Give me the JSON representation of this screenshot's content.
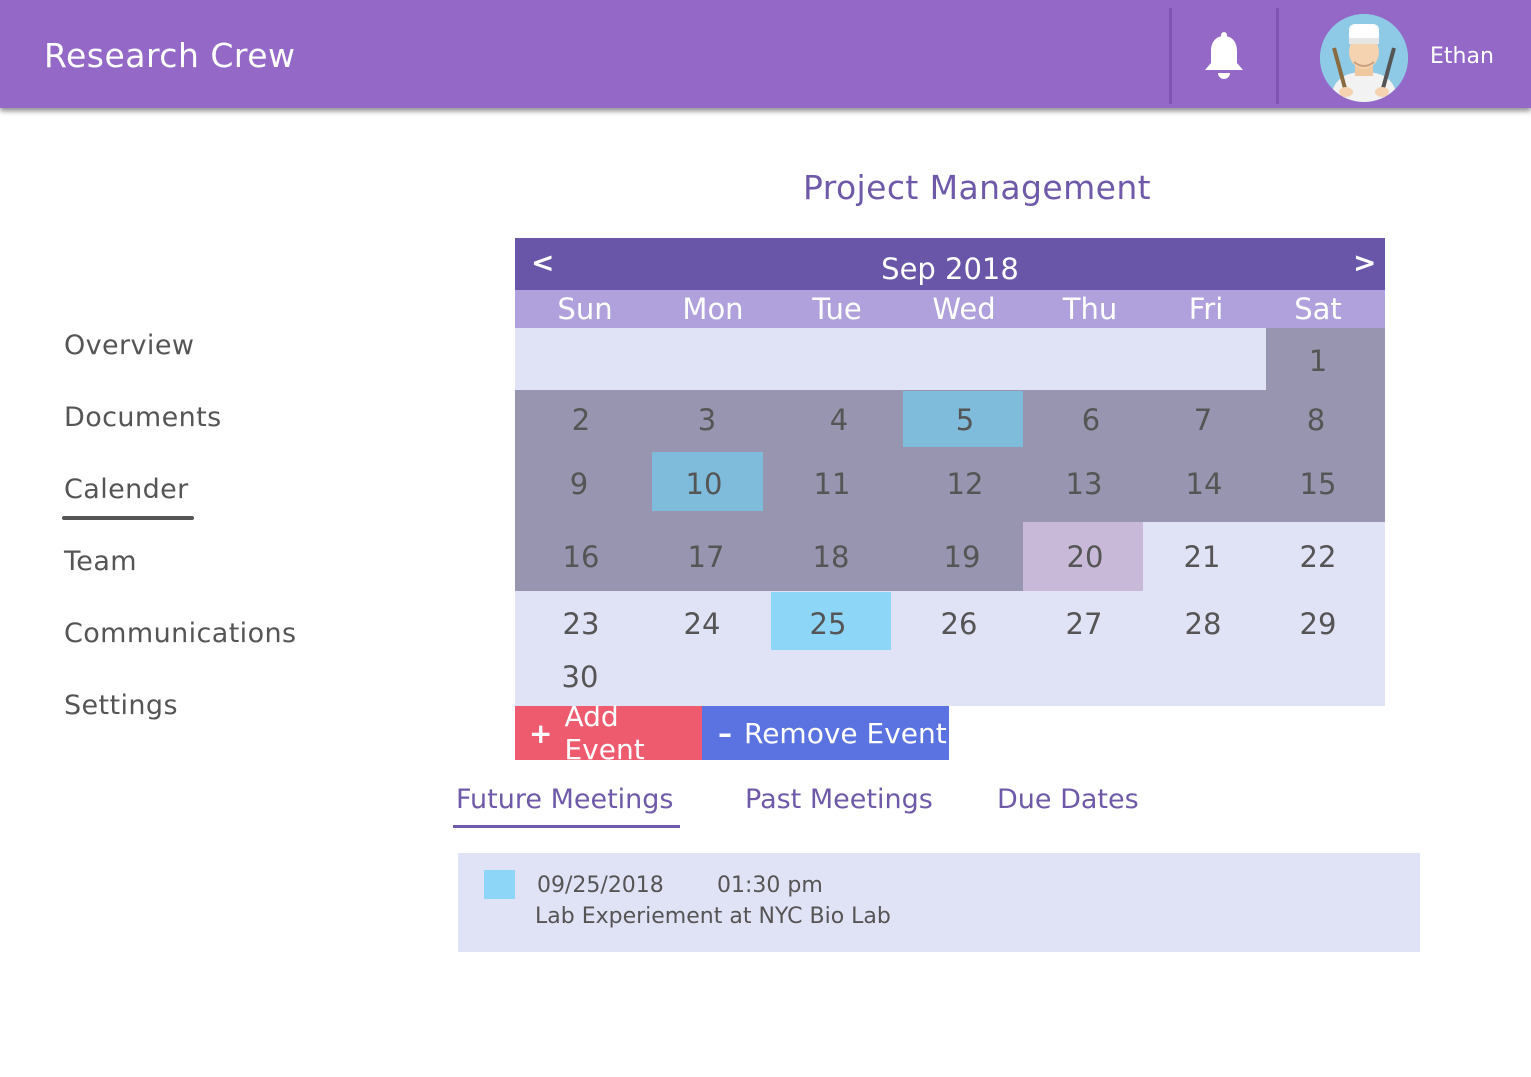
{
  "header": {
    "app_title": "Research Crew",
    "user_name": "Ethan",
    "bell_icon": "bell-icon",
    "avatar_icon": "chef-avatar"
  },
  "sidebar": {
    "items": [
      {
        "label": "Overview"
      },
      {
        "label": "Documents"
      },
      {
        "label": "Calender",
        "active": true
      },
      {
        "label": "Team"
      },
      {
        "label": "Communications"
      },
      {
        "label": "Settings"
      }
    ]
  },
  "main": {
    "page_title": "Project Management",
    "calendar": {
      "month_label": "Sep 2018",
      "prev_label": "<",
      "next_label": ">",
      "weekdays": [
        "Sun",
        "Mon",
        "Tue",
        "Wed",
        "Thu",
        "Fri",
        "Sat"
      ],
      "days": [
        "1",
        "2",
        "3",
        "4",
        "5",
        "6",
        "7",
        "8",
        "9",
        "10",
        "11",
        "12",
        "13",
        "14",
        "15",
        "16",
        "17",
        "18",
        "19",
        "20",
        "21",
        "22",
        "23",
        "24",
        "25",
        "26",
        "27",
        "28",
        "29",
        "30"
      ],
      "highlighted_days": [
        "5",
        "10",
        "20",
        "25"
      ],
      "colors": {
        "past": "#9895b0",
        "future": "#e0e2f6",
        "event": "#7fbcdc",
        "today": "#c8b9d9",
        "upcoming_event": "#8ed6f8"
      }
    },
    "actions": {
      "add_symbol": "+",
      "add_label": "Add Event",
      "remove_symbol": "–",
      "remove_label": "Remove Event",
      "add_color": "#ef5b6e",
      "remove_color": "#5a73e0"
    },
    "tabs": [
      {
        "label": "Future Meetings",
        "active": true
      },
      {
        "label": "Past Meetings"
      },
      {
        "label": "Due Dates"
      }
    ],
    "meetings": [
      {
        "date": "09/25/2018",
        "time": "01:30 pm",
        "title": "Lab Experiement at NYC Bio Lab",
        "color": "#8ed6f8"
      }
    ]
  },
  "colors": {
    "topbar": "#9468c6",
    "accent": "#6a56a8",
    "weekday_bar": "#b0a1dc"
  }
}
